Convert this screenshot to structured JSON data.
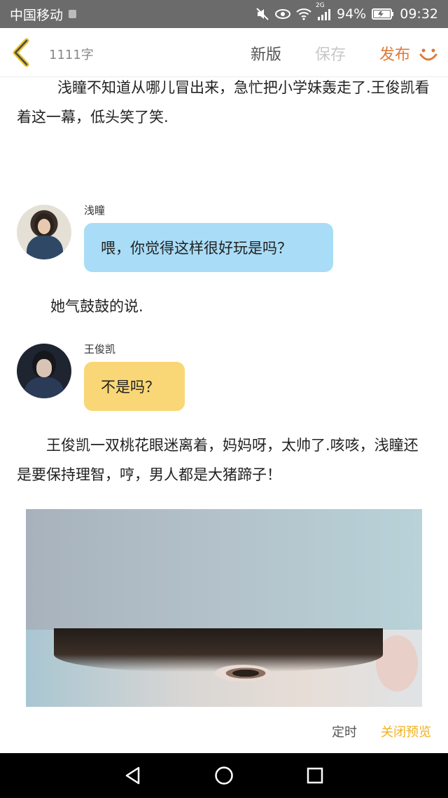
{
  "status_bar": {
    "carrier": "中国移动",
    "network": "2G",
    "battery": "94%",
    "time": "09:32",
    "icons": [
      "mute-icon",
      "eye-icon",
      "wifi-icon",
      "signal-icon",
      "battery-icon"
    ]
  },
  "toolbar": {
    "word_count": "1111字",
    "new_version": "新版",
    "save": "保存",
    "publish": "发布",
    "accent_color": "#e07a35"
  },
  "content": {
    "paragraph1": "浅瞳不知道从哪儿冒出来，急忙把小学妹轰走了.王俊凯看着这一幕，低头笑了笑.",
    "chat1": {
      "name": "浅瞳",
      "message": "喂，你觉得这样很好玩是吗？",
      "bubble_color": "#a9dcf7"
    },
    "paragraph2": "她气鼓鼓的说.",
    "chat2": {
      "name": "王俊凯",
      "message": "不是吗？",
      "bubble_color": "#f9d776"
    },
    "paragraph3": "王俊凯一双桃花眼迷离着，妈妈呀，太帅了.咳咳，浅瞳还是要保持理智，哼，男人都是大猪蹄子！"
  },
  "actions": {
    "timer": "定时",
    "close_preview": "关闭预览",
    "close_color": "#f0b21e"
  },
  "nav": {
    "icons": [
      "back-triangle-icon",
      "home-circle-icon",
      "recent-square-icon"
    ]
  }
}
